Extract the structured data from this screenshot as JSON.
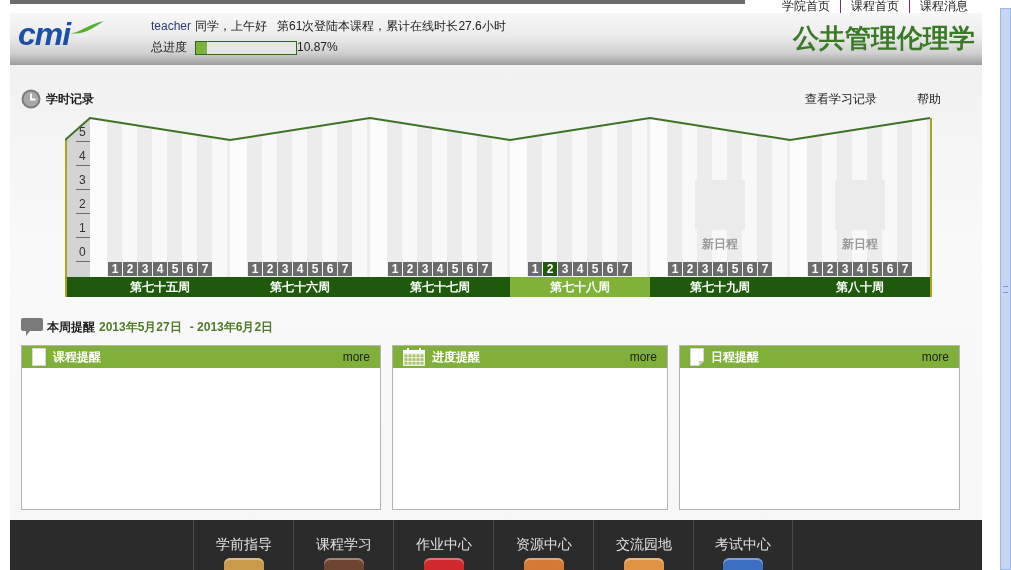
{
  "top_links": [
    "学院首页",
    "课程首页",
    "课程消息"
  ],
  "header": {
    "logo": "cmi",
    "user": "teacher",
    "greeting": "同学，上午好",
    "login_info": "第61次登陆本课程，累计在线时长27.6小时",
    "progress": {
      "label": "总进度",
      "level": 0.1087,
      "reading": "10.87%"
    },
    "course_title": "公共管理伦理学"
  },
  "study_record": {
    "title": "学时记录",
    "links": [
      "查看学习记录",
      "帮助"
    ],
    "y_ticks": [
      "5",
      "4",
      "3",
      "2",
      "1",
      "0"
    ],
    "weeks": [
      {
        "label": "第七十五周",
        "selected": false,
        "days": [
          {
            "label": "1",
            "selected": false
          },
          {
            "label": "2",
            "selected": false
          },
          {
            "label": "3",
            "selected": false
          },
          {
            "label": "4",
            "selected": false
          },
          {
            "label": "5",
            "selected": false
          },
          {
            "label": "6",
            "selected": false
          },
          {
            "label": "7",
            "selected": false
          }
        ]
      },
      {
        "label": "第七十六周",
        "selected": false,
        "days": [
          {
            "label": "1",
            "selected": false
          },
          {
            "label": "2",
            "selected": false
          },
          {
            "label": "3",
            "selected": false
          },
          {
            "label": "4",
            "selected": false
          },
          {
            "label": "5",
            "selected": false
          },
          {
            "label": "6",
            "selected": false
          },
          {
            "label": "7",
            "selected": false
          }
        ]
      },
      {
        "label": "第七十七周",
        "selected": false,
        "days": [
          {
            "label": "1",
            "selected": false
          },
          {
            "label": "2",
            "selected": false
          },
          {
            "label": "3",
            "selected": false
          },
          {
            "label": "4",
            "selected": false
          },
          {
            "label": "5",
            "selected": false
          },
          {
            "label": "6",
            "selected": false
          },
          {
            "label": "7",
            "selected": false
          }
        ]
      },
      {
        "label": "第七十八周",
        "selected": true,
        "days": [
          {
            "label": "1",
            "selected": false
          },
          {
            "label": "2",
            "selected": true
          },
          {
            "label": "3",
            "selected": false
          },
          {
            "label": "4",
            "selected": false
          },
          {
            "label": "5",
            "selected": false
          },
          {
            "label": "6",
            "selected": false
          },
          {
            "label": "7",
            "selected": false
          }
        ]
      },
      {
        "label": "第七十九周",
        "selected": false,
        "new_schedule": "新日程",
        "days": [
          {
            "label": "1",
            "selected": false
          },
          {
            "label": "2",
            "selected": false
          },
          {
            "label": "3",
            "selected": false
          },
          {
            "label": "4",
            "selected": false
          },
          {
            "label": "5",
            "selected": false
          },
          {
            "label": "6",
            "selected": false
          },
          {
            "label": "7",
            "selected": false
          }
        ]
      },
      {
        "label": "第八十周",
        "selected": false,
        "new_schedule": "新日程",
        "days": [
          {
            "label": "1",
            "selected": false
          },
          {
            "label": "2",
            "selected": false
          },
          {
            "label": "3",
            "selected": false
          },
          {
            "label": "4",
            "selected": false
          },
          {
            "label": "5",
            "selected": false
          },
          {
            "label": "6",
            "selected": false
          },
          {
            "label": "7",
            "selected": false
          }
        ]
      }
    ]
  },
  "weekly_reminders": {
    "title": "本周提醒",
    "date_start": "2013年5月27日",
    "date_end": "- 2013年6月2日",
    "panels": [
      {
        "kind": "document",
        "title": "课程提醒",
        "more": "more"
      },
      {
        "kind": "calendar",
        "title": "进度提醒",
        "more": "more"
      },
      {
        "kind": "note",
        "title": "日程提醒",
        "more": "more"
      }
    ]
  },
  "nav": [
    {
      "label": "学前指导",
      "color": "#c89a4a"
    },
    {
      "label": "课程学习",
      "color": "#6e4530"
    },
    {
      "label": "作业中心",
      "color": "#d0282c"
    },
    {
      "label": "资源中心",
      "color": "#d47a34"
    },
    {
      "label": "交流园地",
      "color": "#e09444"
    },
    {
      "label": "考试中心",
      "color": "#3a6fc2"
    }
  ]
}
